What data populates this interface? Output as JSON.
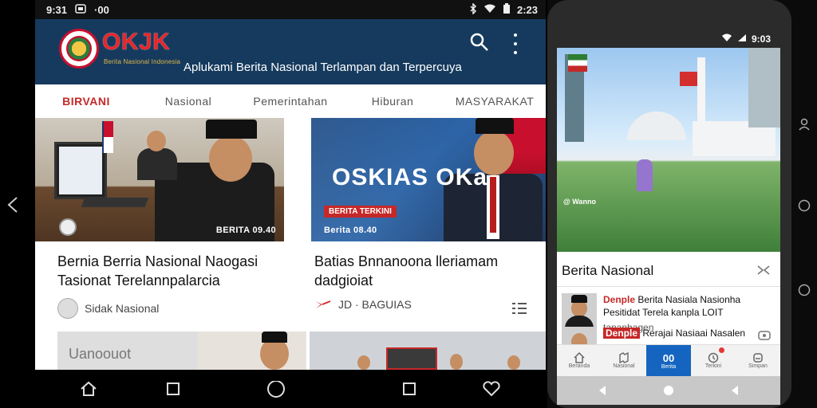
{
  "tablet": {
    "status": {
      "time": "9:31",
      "left_icon": "9:31",
      "right": "2:23"
    },
    "header": {
      "logo": "OKJK",
      "logo_sub": "Berita Nasional Indonesia",
      "tagline": "Aplukami Berita Nasional Terlampan dan Terpercuya",
      "search_icon": "search-icon",
      "menu_icon": "more-vert-icon"
    },
    "tabs": [
      {
        "label": "BIRVANI",
        "active": true
      },
      {
        "label": "Nasional",
        "active": false
      },
      {
        "label": "Pemerintahan",
        "active": false
      },
      {
        "label": "Hiburan",
        "active": false
      },
      {
        "label": "MASYARAKAT",
        "active": false
      }
    ],
    "cards": [
      {
        "image_caption": "BERITA 09.40",
        "title": "Bernia Berria Nasional Naogasi Tasionat Terelannpalarcia",
        "source": "Sidak Nasional"
      },
      {
        "image_overlay": "OSKIAS OKa",
        "image_chip": "BERITA TERKINI",
        "image_caption": "Berita 08.40",
        "title": "Batias Bnnanoona lleriamam dadgioiat",
        "source": "JD · BAGUIAS"
      }
    ],
    "second_row": {
      "left_text": "Uanoouot"
    },
    "colors": {
      "header": "#163a5e",
      "accent": "#c62828"
    }
  },
  "phone": {
    "status": {
      "time": "9:03"
    },
    "hero_caption": "@ Wanno",
    "section_title": "Berita Nasional",
    "items": [
      {
        "highlight": "Denple",
        "text": "Berita Nasiala Nasionha Pesitidat Terela kanpla LOIT",
        "source": "tananhagen"
      },
      {
        "highlight": "Denple",
        "text": "Rerajai Nasiaai Nasalen",
        "source": ""
      }
    ],
    "bottom_nav": [
      {
        "label": "Beranda",
        "active": false
      },
      {
        "label": "Nasional",
        "active": false
      },
      {
        "label": "Berita",
        "active": true,
        "badge": "00"
      },
      {
        "label": "Terkini",
        "active": false
      },
      {
        "label": "Simpan",
        "active": false
      }
    ],
    "colors": {
      "nav_active": "#1565c0"
    }
  }
}
